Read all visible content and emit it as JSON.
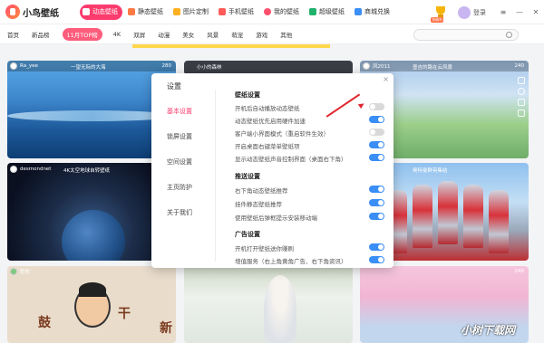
{
  "app": {
    "title": "小鸟壁纸"
  },
  "nav_tabs": [
    {
      "label": "动态壁纸",
      "icon": "play-icon",
      "active": true
    },
    {
      "label": "静态壁纸",
      "icon": "image-icon"
    },
    {
      "label": "图片定制",
      "icon": "custom-icon"
    },
    {
      "label": "手机壁纸",
      "icon": "phone-icon"
    },
    {
      "label": "我的壁纸",
      "icon": "heart-icon"
    },
    {
      "label": "超级壁纸",
      "icon": "star-icon"
    },
    {
      "label": "商城兑换",
      "icon": "shop-icon"
    }
  ],
  "topright": {
    "login": "登录",
    "trophy_badge": "领福利"
  },
  "categories": [
    "首页",
    "新品榜",
    "11月TOP榜",
    "4K",
    "双屏",
    "动漫",
    "美女",
    "风景",
    "萌宠",
    "游戏",
    "其他"
  ],
  "cards": {
    "c1": {
      "user": "Ra_yee",
      "title": "一望无际的大海",
      "count": "280"
    },
    "c2": {
      "title": "小小的森林"
    },
    "c3": {
      "user": "风2011",
      "title": "壹吉的路在云风景",
      "count": "240"
    },
    "c4": {
      "user": "desmondnet",
      "title": "4K太空地球自转壁纸"
    },
    "c6": {
      "title": "奥特曼群英集结"
    },
    "c7": {
      "user": "愁愁",
      "glyph1": "鼓",
      "glyph2": "干",
      "glyph3": "新"
    },
    "c9": {
      "count": "240"
    }
  },
  "settings": {
    "title": "设置",
    "nav": [
      "基本设置",
      "锁屏设置",
      "空间设置",
      "主页防护",
      "关于我们"
    ],
    "sections": [
      {
        "title": "壁纸设置",
        "options": [
          {
            "label": "开机后自动播放动态壁纸",
            "on": false
          },
          {
            "label": "动态壁纸优先启用硬件加速",
            "on": true
          },
          {
            "label": "客户端小界面模式（重启软件生效）",
            "on": false
          },
          {
            "label": "开启桌面右键菜单壁纸项",
            "on": true
          },
          {
            "label": "显示动态壁纸声音控制界面（桌面右下角）",
            "on": true
          }
        ]
      },
      {
        "title": "推送设置",
        "options": [
          {
            "label": "右下角动态壁纸推荐",
            "on": true
          },
          {
            "label": "挂件静态壁纸推荐",
            "on": true
          },
          {
            "label": "使用壁纸后弹框提示安装移动端",
            "on": true
          }
        ]
      },
      {
        "title": "广告设置",
        "options": [
          {
            "label": "开机打开壁纸送你赚刷",
            "on": true
          },
          {
            "label": "增值服务（右上角黄角广告、右下角资讯）",
            "on": true
          }
        ]
      }
    ]
  },
  "watermark": "小树下载网",
  "colors": {
    "accent": "#fb3c6d",
    "toggle_on": "#3a8ef6",
    "toggle_off": "#d9d9d9",
    "annotation_arrow": "#e0262e"
  }
}
